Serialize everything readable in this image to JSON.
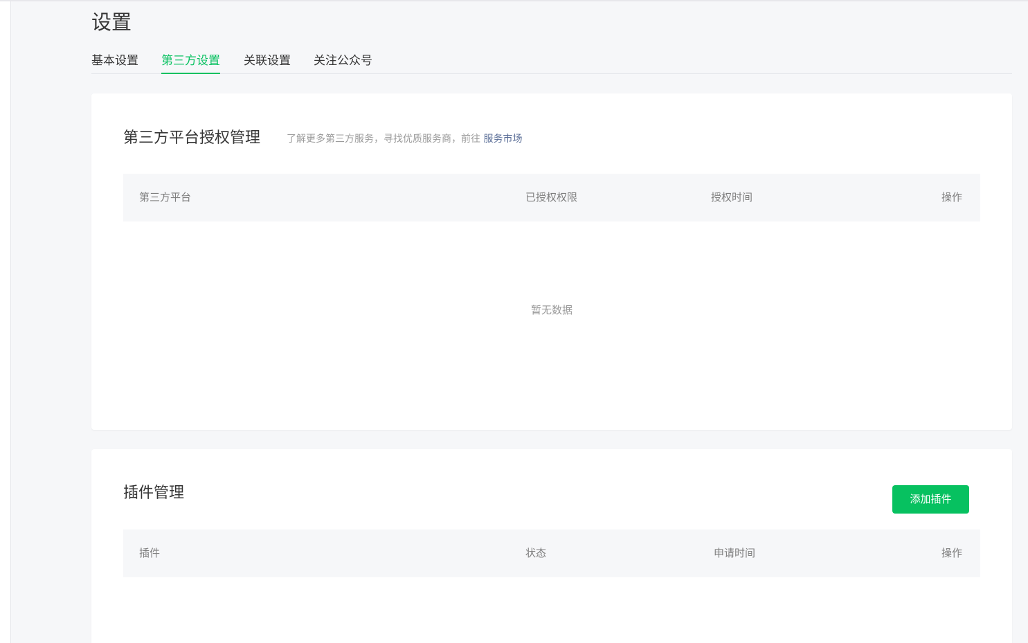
{
  "page": {
    "title": "设置"
  },
  "tabs": [
    {
      "label": "基本设置",
      "active": false
    },
    {
      "label": "第三方设置",
      "active": true
    },
    {
      "label": "关联设置",
      "active": false
    },
    {
      "label": "关注公众号",
      "active": false
    }
  ],
  "auth_section": {
    "title": "第三方平台授权管理",
    "desc_prefix": "了解更多第三方服务，寻找优质服务商，前往 ",
    "desc_link": "服务市场",
    "columns": [
      "第三方平台",
      "已授权权限",
      "授权时间",
      "操作"
    ],
    "empty_text": "暂无数据"
  },
  "plugin_section": {
    "title": "插件管理",
    "add_button": "添加插件",
    "columns": [
      "插件",
      "状态",
      "申请时间",
      "操作"
    ]
  },
  "colors": {
    "accent": "#07c160",
    "link": "#576b95",
    "page_bg": "#f6f7f9",
    "table_header_bg": "#f6f7f9"
  }
}
